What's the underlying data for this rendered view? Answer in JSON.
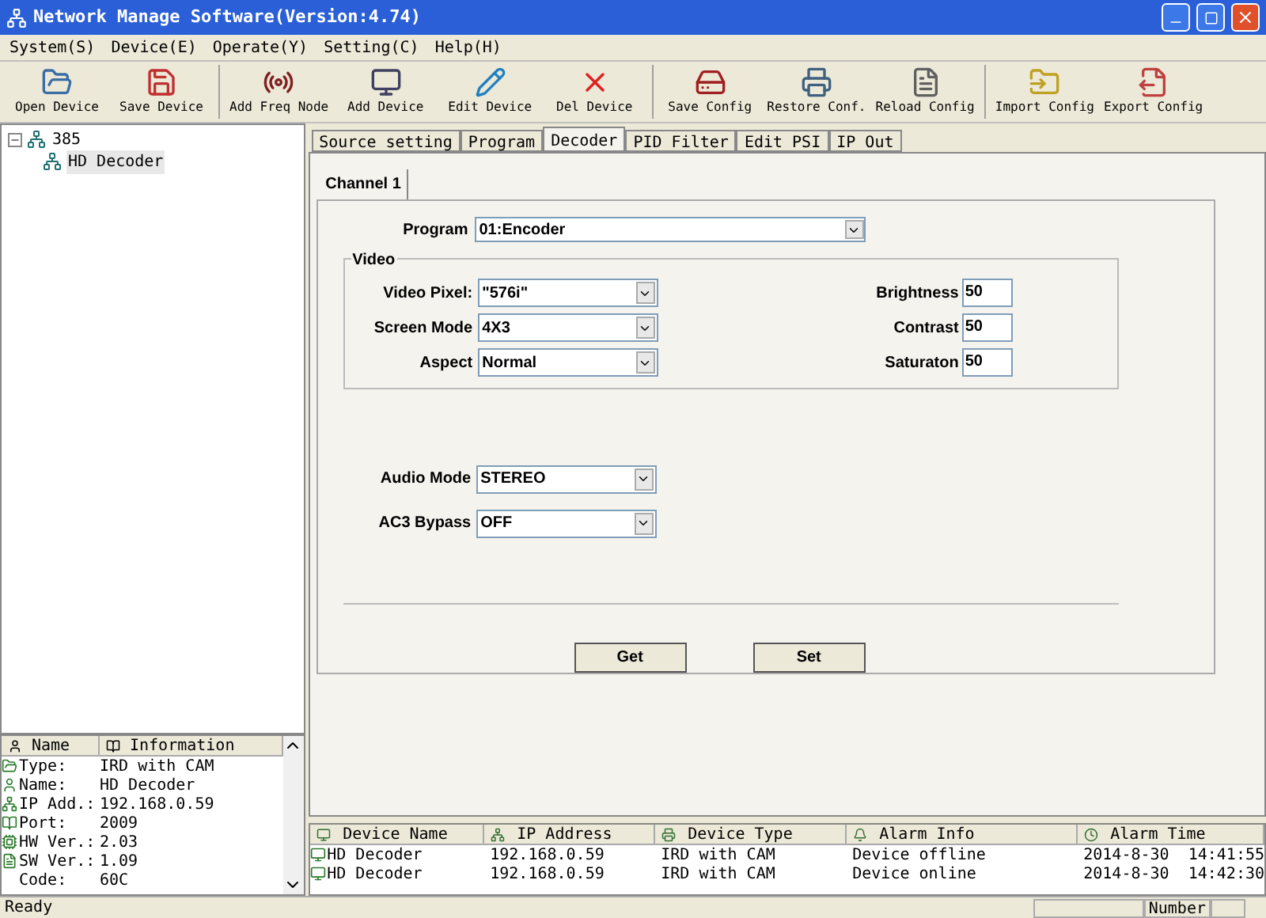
{
  "window": {
    "title": "Network Manage Software(Version:4.74)"
  },
  "menu": [
    "System(S)",
    "Device(E)",
    "Operate(Y)",
    "Setting(C)",
    "Help(H)"
  ],
  "toolbar": [
    {
      "label": "Open Device",
      "kind": "open"
    },
    {
      "label": "Save Device",
      "kind": "save"
    },
    {
      "label": "Add Freq Node",
      "kind": "freq"
    },
    {
      "label": "Add Device",
      "kind": "add"
    },
    {
      "label": "Edit Device",
      "kind": "edit"
    },
    {
      "label": "Del Device",
      "kind": "del"
    },
    {
      "label": "Save Config",
      "kind": "saveconf"
    },
    {
      "label": "Restore Conf.",
      "kind": "restore"
    },
    {
      "label": "Reload Config",
      "kind": "reload"
    },
    {
      "label": "Import Config",
      "kind": "import"
    },
    {
      "label": "Export Config",
      "kind": "export"
    }
  ],
  "tree": [
    {
      "label": "385",
      "expanded": true,
      "children": [
        {
          "label": "HD Decoder",
          "selected": true
        }
      ]
    }
  ],
  "info": {
    "columns": [
      "Name",
      "Information"
    ],
    "rows": [
      {
        "name": "Type:",
        "value": "IRD with CAM"
      },
      {
        "name": "Name:",
        "value": "HD Decoder"
      },
      {
        "name": "IP Add.:",
        "value": "192.168.0.59"
      },
      {
        "name": "Port:",
        "value": "2009"
      },
      {
        "name": "HW Ver.:",
        "value": "2.03"
      },
      {
        "name": "SW Ver.:",
        "value": "1.09"
      },
      {
        "name": "Code:",
        "value": "60C"
      }
    ]
  },
  "tabs": [
    {
      "label": "Source setting",
      "selected": false
    },
    {
      "label": "Program",
      "selected": false
    },
    {
      "label": "Decoder",
      "selected": true
    },
    {
      "label": "PID Filter",
      "selected": false
    },
    {
      "label": "Edit PSI",
      "selected": false
    },
    {
      "label": "IP Out",
      "selected": false
    }
  ],
  "channel_tabs": [
    {
      "label": "Channel 1",
      "selected": true
    }
  ],
  "program": {
    "label": "Program",
    "value": "01:Encoder"
  },
  "video": {
    "title": "Video",
    "left": [
      {
        "label": "Video Pixel:",
        "value": "\"576i\""
      },
      {
        "label": "Screen Mode",
        "value": "4X3"
      },
      {
        "label": "Aspect",
        "value": "Normal"
      }
    ],
    "right": [
      {
        "label": "Brightness",
        "value": "50"
      },
      {
        "label": "Contrast",
        "value": "50"
      },
      {
        "label": "Saturaton",
        "value": "50"
      }
    ]
  },
  "audio": [
    {
      "label": "Audio Mode",
      "value": "STEREO"
    },
    {
      "label": "AC3 Bypass",
      "value": "OFF"
    }
  ],
  "buttons": [
    "Get",
    "Set"
  ],
  "alarms": {
    "columns": [
      "Device Name",
      "IP Address",
      "Device Type",
      "Alarm Info",
      "Alarm Time"
    ],
    "rows": [
      [
        "HD Decoder",
        "192.168.0.59",
        "IRD with CAM",
        "Device offline",
        "2014-8-30  14:41:55"
      ],
      [
        "HD Decoder",
        "192.168.0.59",
        "IRD with CAM",
        "Device online",
        "2014-8-30  14:42:30"
      ]
    ]
  },
  "status_bar": {
    "left": "Ready",
    "right": "Number"
  }
}
